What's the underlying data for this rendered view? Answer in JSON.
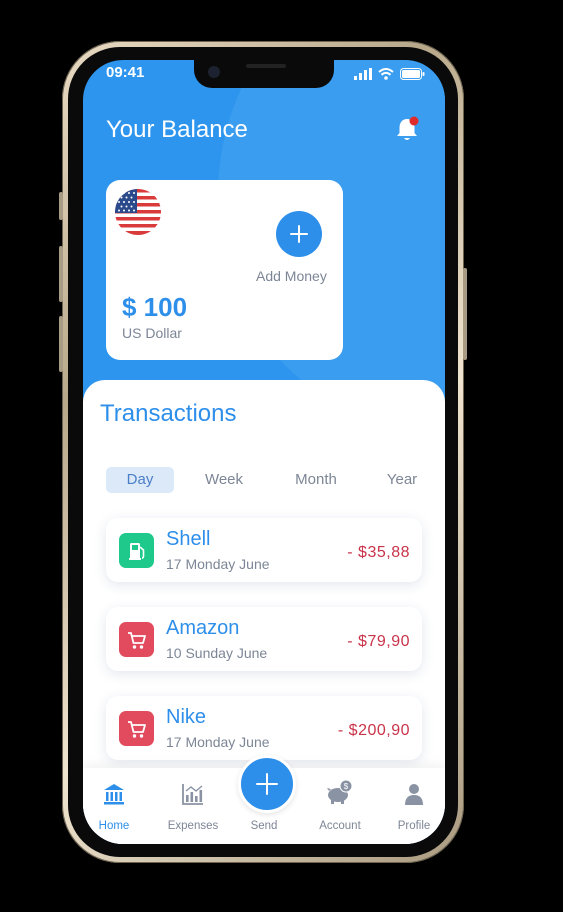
{
  "status_bar": {
    "time": "09:41"
  },
  "header": {
    "title": "Your Balance",
    "notification": true
  },
  "balance_card": {
    "amount": "$ 100",
    "currency": "US Dollar",
    "add_money_label": "Add Money"
  },
  "transactions": {
    "title": "Transactions",
    "tabs": [
      {
        "label": "Day",
        "active": true
      },
      {
        "label": "Week",
        "active": false
      },
      {
        "label": "Month",
        "active": false
      },
      {
        "label": "Year",
        "active": false
      }
    ],
    "items": [
      {
        "name": "Shell",
        "date": "17 Monday June",
        "amount": "- $35,88",
        "icon": "fuel-icon",
        "color": "#1ec98b"
      },
      {
        "name": "Amazon",
        "date": "10 Sunday June",
        "amount": "- $79,90",
        "icon": "cart-icon",
        "color": "#e24a5e"
      },
      {
        "name": "Nike",
        "date": "17 Monday June",
        "amount": "- $200,90",
        "icon": "cart-icon",
        "color": "#e24a5e"
      }
    ]
  },
  "nav": {
    "items": [
      {
        "label": "Home",
        "icon": "bank-icon",
        "active": true
      },
      {
        "label": "Expenses",
        "icon": "chart-icon",
        "active": false
      },
      {
        "label": "Send",
        "icon": "plus-icon",
        "active": false
      },
      {
        "label": "Account",
        "icon": "piggy-bank-icon",
        "active": false
      },
      {
        "label": "Profile",
        "icon": "user-icon",
        "active": false
      }
    ]
  },
  "colors": {
    "primary": "#2e8fea",
    "header_bg": "#2e95ee",
    "expense": "#c9334a",
    "fuel": "#1ec98b",
    "shopping": "#e24a5e"
  }
}
